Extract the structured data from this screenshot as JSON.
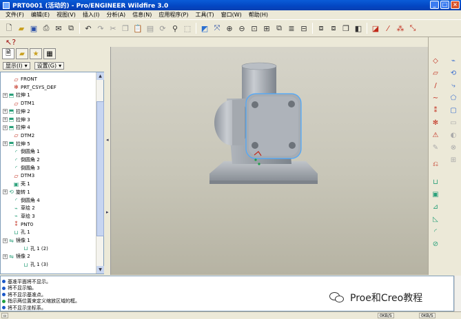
{
  "window": {
    "title": "PRT0001 (活动的) - Pro/ENGINEER Wildfire 3.0"
  },
  "menu": [
    "文件(F)",
    "编辑(E)",
    "视图(V)",
    "插入(I)",
    "分析(A)",
    "信息(N)",
    "应用程序(P)",
    "工具(T)",
    "窗口(W)",
    "帮助(H)"
  ],
  "navigator": {
    "show_label": "显示(I)",
    "settings_label": "设置(G)"
  },
  "tree": [
    {
      "label": "FRONT",
      "icon": "datum-plane-icon",
      "expand": false,
      "indent": 1
    },
    {
      "label": "PRT_CSYS_DEF",
      "icon": "csys-icon",
      "expand": false,
      "indent": 1
    },
    {
      "label": "拉伸 1",
      "icon": "extrude-icon",
      "expand": true,
      "indent": 0
    },
    {
      "label": "DTM1",
      "icon": "datum-plane-icon",
      "expand": false,
      "indent": 1
    },
    {
      "label": "拉伸 2",
      "icon": "extrude-icon",
      "expand": true,
      "indent": 0
    },
    {
      "label": "拉伸 3",
      "icon": "extrude-icon",
      "expand": true,
      "indent": 0
    },
    {
      "label": "拉伸 4",
      "icon": "extrude-icon",
      "expand": true,
      "indent": 0
    },
    {
      "label": "DTM2",
      "icon": "datum-plane-icon",
      "expand": false,
      "indent": 1
    },
    {
      "label": "拉伸 5",
      "icon": "extrude-icon",
      "expand": true,
      "indent": 0
    },
    {
      "label": "倒圆角 1",
      "icon": "round-icon",
      "expand": false,
      "indent": 1
    },
    {
      "label": "倒圆角 2",
      "icon": "round-icon",
      "expand": false,
      "indent": 1
    },
    {
      "label": "倒圆角 3",
      "icon": "round-icon",
      "expand": false,
      "indent": 1
    },
    {
      "label": "DTM3",
      "icon": "datum-plane-icon",
      "expand": false,
      "indent": 1
    },
    {
      "label": "壳 1",
      "icon": "shell-icon",
      "expand": false,
      "indent": 1
    },
    {
      "label": "旋转 1",
      "icon": "revolve-icon",
      "expand": true,
      "indent": 0
    },
    {
      "label": "倒圆角 4",
      "icon": "round-icon",
      "expand": false,
      "indent": 1
    },
    {
      "label": "草绘 2",
      "icon": "sketch-icon",
      "expand": false,
      "indent": 1
    },
    {
      "label": "草绘 3",
      "icon": "sketch-icon",
      "expand": false,
      "indent": 1
    },
    {
      "label": "PNT0",
      "icon": "datum-point-icon",
      "expand": false,
      "indent": 1
    },
    {
      "label": "孔 1",
      "icon": "hole-icon",
      "expand": false,
      "indent": 1
    },
    {
      "label": "镜像 1",
      "icon": "mirror-icon",
      "expand": true,
      "indent": 0
    },
    {
      "label": "孔 1 (2)",
      "icon": "hole-icon",
      "expand": false,
      "indent": 3
    },
    {
      "label": "镜像 2",
      "icon": "mirror-icon",
      "expand": true,
      "indent": 0
    },
    {
      "label": "孔 1 (3)",
      "icon": "hole-icon",
      "expand": false,
      "indent": 3
    }
  ],
  "messages": [
    {
      "text": "基准平面将不显示。",
      "kind": "info"
    },
    {
      "text": "将不显示轴。",
      "kind": "info"
    },
    {
      "text": "将不显示基准点。",
      "kind": "info"
    },
    {
      "text": "指示两位置来定义缩放区域的框。",
      "kind": "prompt"
    },
    {
      "text": "将不显示坐标系。",
      "kind": "info"
    }
  ],
  "status": {
    "rate1": "0KB/S",
    "rate2": "0KB/S"
  },
  "watermark": {
    "text": "Proe和Creo教程"
  },
  "colors": {
    "part": "#9aa0a8",
    "highlight": "#4aa8ff",
    "title": "#0a4bd0"
  }
}
